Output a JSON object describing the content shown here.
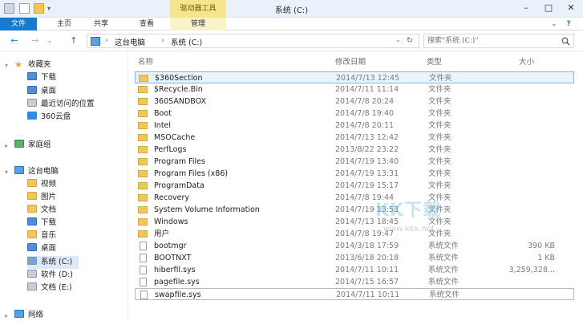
{
  "window": {
    "title": "系统 (C:)",
    "tool_tab_header": "驱动器工具",
    "minimize_glyph": "–",
    "maximize_glyph": "□",
    "close_glyph": "✕"
  },
  "ribbon": {
    "tabs": [
      "文件",
      "主页",
      "共享",
      "查看",
      "管理"
    ],
    "expand_glyph": "⌄",
    "help_glyph": "?"
  },
  "address_bar": {
    "back_glyph": "←",
    "forward_glyph": "→",
    "dropdown_glyph": "⌄",
    "up_glyph": "↑",
    "separator_glyph": "›",
    "path": [
      "这台电脑",
      "系统 (C:)"
    ],
    "refresh_glyph": "↻"
  },
  "search": {
    "placeholder": "搜索\"系统 (C:)\"",
    "icon": "search-icon"
  },
  "sidebar": {
    "favorites": {
      "label": "收藏夹",
      "items": [
        "下载",
        "桌面",
        "最近访问的位置",
        "360云盘"
      ]
    },
    "homegroup": {
      "label": "家庭组"
    },
    "this_pc": {
      "label": "这台电脑",
      "items": [
        "视频",
        "图片",
        "文档",
        "下载",
        "音乐",
        "桌面",
        "系统 (C:)",
        "软件 (D:)",
        "文档 (E:)"
      ]
    },
    "network": {
      "label": "网络"
    }
  },
  "columns": {
    "name": "名称",
    "date": "修改日期",
    "type": "类型",
    "size": "大小"
  },
  "files": [
    {
      "name": "$360Section",
      "date": "2014/7/13 12:45",
      "type": "文件夹",
      "size": "",
      "kind": "folder"
    },
    {
      "name": "$Recycle.Bin",
      "date": "2014/7/11 11:14",
      "type": "文件夹",
      "size": "",
      "kind": "folder"
    },
    {
      "name": "360SANDBOX",
      "date": "2014/7/8 20:24",
      "type": "文件夹",
      "size": "",
      "kind": "folder"
    },
    {
      "name": "Boot",
      "date": "2014/7/8 19:40",
      "type": "文件夹",
      "size": "",
      "kind": "folder"
    },
    {
      "name": "Intel",
      "date": "2014/7/8 20:11",
      "type": "文件夹",
      "size": "",
      "kind": "folder"
    },
    {
      "name": "MSOCache",
      "date": "2014/7/13 12:42",
      "type": "文件夹",
      "size": "",
      "kind": "folder"
    },
    {
      "name": "PerfLogs",
      "date": "2013/8/22 23:22",
      "type": "文件夹",
      "size": "",
      "kind": "folder"
    },
    {
      "name": "Program Files",
      "date": "2014/7/19 13:40",
      "type": "文件夹",
      "size": "",
      "kind": "folder"
    },
    {
      "name": "Program Files (x86)",
      "date": "2014/7/19 13:31",
      "type": "文件夹",
      "size": "",
      "kind": "folder"
    },
    {
      "name": "ProgramData",
      "date": "2014/7/19 15:17",
      "type": "文件夹",
      "size": "",
      "kind": "folder"
    },
    {
      "name": "Recovery",
      "date": "2014/7/8 19:44",
      "type": "文件夹",
      "size": "",
      "kind": "folder"
    },
    {
      "name": "System Volume Information",
      "date": "2014/7/19 13:53",
      "type": "文件夹",
      "size": "",
      "kind": "folder"
    },
    {
      "name": "Windows",
      "date": "2014/7/13 18:45",
      "type": "文件夹",
      "size": "",
      "kind": "folder"
    },
    {
      "name": "用户",
      "date": "2014/7/8 19:47",
      "type": "文件夹",
      "size": "",
      "kind": "folder"
    },
    {
      "name": "bootmgr",
      "date": "2014/3/18 17:59",
      "type": "系统文件",
      "size": "390 KB",
      "kind": "file"
    },
    {
      "name": "BOOTNXT",
      "date": "2013/6/18 20:18",
      "type": "系统文件",
      "size": "1 KB",
      "kind": "file"
    },
    {
      "name": "hiberfil.sys",
      "date": "2014/7/11 10:11",
      "type": "系统文件",
      "size": "3,259,328...",
      "kind": "file"
    },
    {
      "name": "pagefile.sys",
      "date": "2014/7/15 16:57",
      "type": "系统文件",
      "size": "",
      "kind": "file"
    },
    {
      "name": "swapfile.sys",
      "date": "2014/7/11 10:11",
      "type": "系统文件",
      "size": "",
      "kind": "file"
    }
  ],
  "selected_file": "$360Section",
  "focused_file": "swapfile.sys",
  "watermark": {
    "logo": "KK下载",
    "url": "www.kkx.net"
  },
  "colors": {
    "file_tab": "#1979ca",
    "tool_tab": "#f6e68b",
    "selection": "#eaf4fd",
    "folder": "#f0c75a"
  }
}
